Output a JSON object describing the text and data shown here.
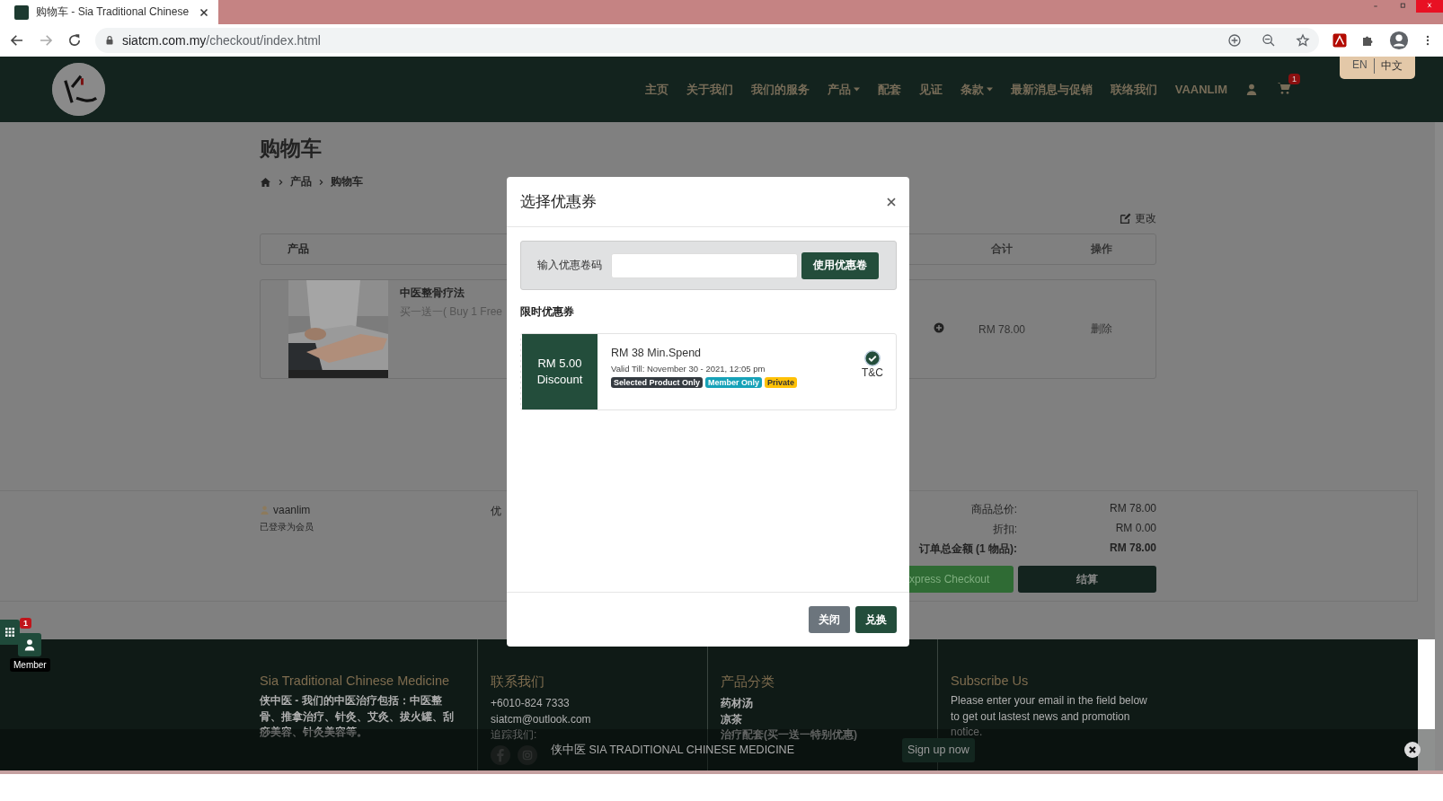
{
  "browser": {
    "tab_title": "购物车 - Sia Traditional Chinese",
    "url_host": "siatcm.com.my",
    "url_path": "/checkout/index.html"
  },
  "site_nav": {
    "languages": [
      {
        "label": "EN",
        "selected": false
      },
      {
        "label": "中文",
        "selected": true
      }
    ],
    "items": [
      {
        "label": "主页",
        "dropdown": false
      },
      {
        "label": "关于我们",
        "dropdown": false
      },
      {
        "label": "我们的服务",
        "dropdown": false
      },
      {
        "label": "产品",
        "dropdown": true
      },
      {
        "label": "配套",
        "dropdown": false
      },
      {
        "label": "见证",
        "dropdown": false
      },
      {
        "label": "条款",
        "dropdown": true
      },
      {
        "label": "最新消息与促销",
        "dropdown": false
      },
      {
        "label": "联络我们",
        "dropdown": false
      }
    ],
    "user": "VAANLIM",
    "cart_count": "1"
  },
  "page": {
    "title": "购物车",
    "breadcrumb": [
      "产品",
      "购物车"
    ],
    "edit_link": "更改",
    "columns": [
      {
        "label": "产品",
        "kind": "product"
      },
      {
        "label": "合计",
        "kind": "total"
      },
      {
        "label": "操作",
        "kind": "action"
      }
    ],
    "item": {
      "name": "中医整骨疗法",
      "note": "买一送一( Buy 1 Free",
      "total": "RM 78.00",
      "action": "删除"
    },
    "summary": {
      "user": "vaanlim",
      "user_status": "已登录为会员",
      "coupon_label": "优",
      "rows": [
        {
          "label": "商品总价:",
          "value": "RM 78.00",
          "bold": false
        },
        {
          "label": "折扣:",
          "value": "RM 0.00",
          "bold": false
        },
        {
          "label": "订单总金额 (1 物品):",
          "value": "RM 78.00",
          "bold": true
        }
      ],
      "express_button": "xpress Checkout",
      "checkout_button": "结算"
    }
  },
  "modal": {
    "title": "选择优惠券",
    "code_label": "输入优惠卷码",
    "apply_button": "使用优惠卷",
    "section_title": "限时优惠券",
    "coupons": [
      {
        "amount": "RM 5.00",
        "amount_label": "Discount",
        "min_spend": "RM 38 Min.Spend",
        "valid_till": "Valid Till: November 30 - 2021, 12:05 pm",
        "tnc": "T&C",
        "selected": true,
        "tags": [
          {
            "label": "Selected Product Only",
            "color": "#343a40"
          },
          {
            "label": "Member Only",
            "color": "#17a2b8"
          },
          {
            "label": "Private",
            "color": "#ffc107"
          }
        ]
      }
    ],
    "close_button": "关闭",
    "redeem_button": "兑换"
  },
  "widget": {
    "badge": "1",
    "label": "Member"
  },
  "footer": {
    "columns": [
      {
        "title": "Sia Traditional Chinese Medicine",
        "kind": "text",
        "lines": [
          "侠中医 - 我们的中医治疗包括：中医整骨、推拿治疗、针灸、艾灸、拔火罐、刮痧美容、针灸美容等。"
        ]
      },
      {
        "title": "联系我们",
        "kind": "contact",
        "lines": [
          "+6010-824 7333",
          "siatcm@outlook.com",
          "追踪我们:"
        ]
      },
      {
        "title": "产品分类",
        "kind": "links",
        "lines": [
          "药材汤",
          "凉茶",
          "治疗配套(买一送一特别优惠)"
        ]
      },
      {
        "title": "Subscribe Us",
        "kind": "text",
        "lines": [
          "Please enter your email in the field below to get out lastest news and promotion notice."
        ]
      }
    ]
  },
  "signup_bar": {
    "text": "侠中医 SIA TRADITIONAL CHINESE MEDICINE",
    "button": "Sign up now"
  }
}
